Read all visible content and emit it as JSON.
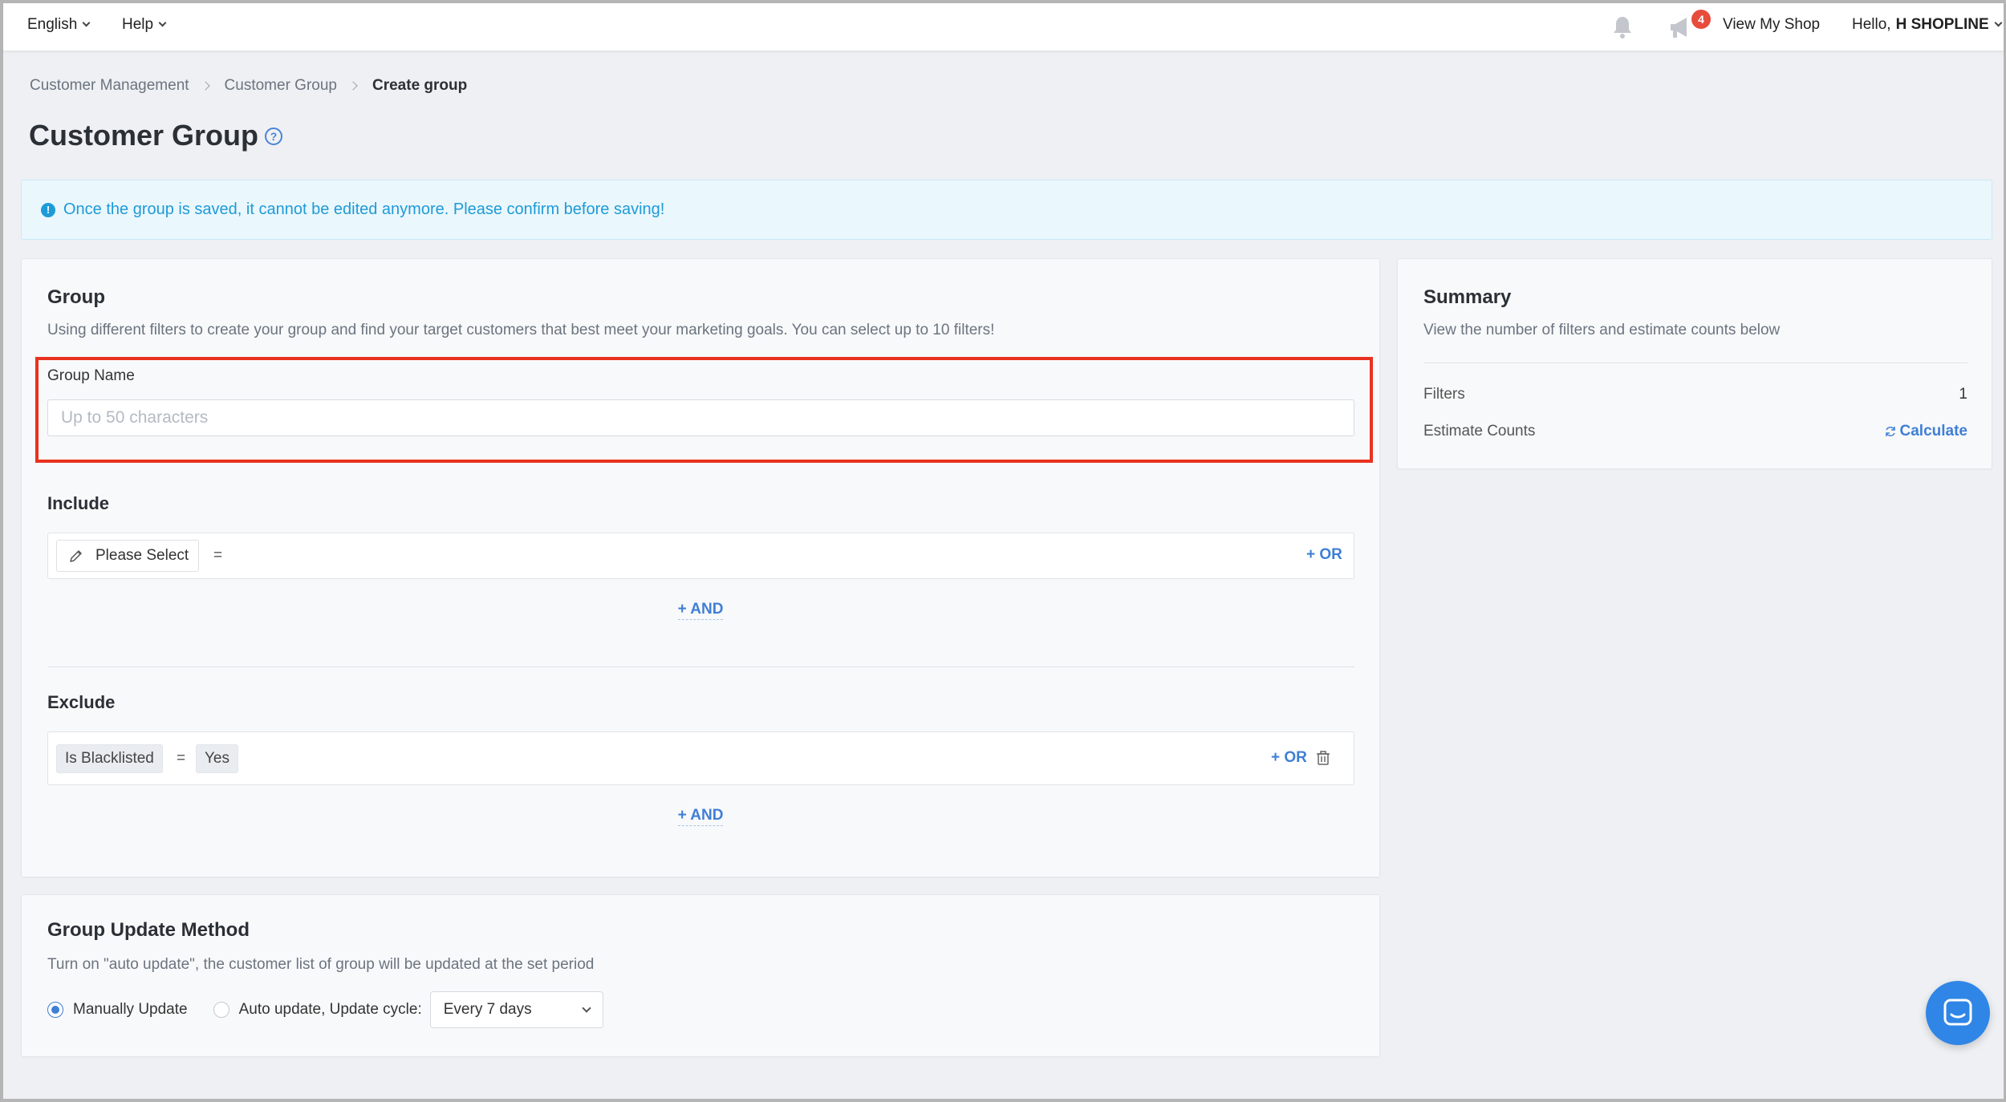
{
  "topbar": {
    "language": "English",
    "help": "Help",
    "notification_badge": "4",
    "view_shop": "View My Shop",
    "hello": "Hello,",
    "user_name": "H SHOPLINE"
  },
  "breadcrumb": [
    "Customer Management",
    "Customer Group",
    "Create group"
  ],
  "page_title": "Customer Group",
  "alert": {
    "icon": "!",
    "text": "Once the group is saved, it cannot be edited anymore. Please confirm before saving!"
  },
  "group": {
    "title": "Group",
    "description": "Using different filters to create your group and find your target customers that best meet your marketing goals. You can select up to 10 filters!",
    "name_label": "Group Name",
    "name_placeholder": "Up to 50 characters",
    "name_value": "",
    "include": {
      "title": "Include",
      "select_label": "Please Select",
      "operator": "=",
      "or_label": "+ OR",
      "and_label": "+ AND"
    },
    "exclude": {
      "title": "Exclude",
      "field": "Is Blacklisted",
      "operator": "=",
      "value": "Yes",
      "or_label": "+ OR",
      "and_label": "+ AND"
    }
  },
  "summary": {
    "title": "Summary",
    "description": "View the number of filters and estimate counts below",
    "filters_label": "Filters",
    "filters_value": "1",
    "estimate_label": "Estimate Counts",
    "calculate_label": "Calculate"
  },
  "update_method": {
    "title": "Group Update Method",
    "description": "Turn on \"auto update\", the customer list of group will be updated at the set period",
    "manual_label": "Manually Update",
    "auto_label": "Auto update, Update cycle:",
    "cycle_value": "Every 7 days",
    "selected": "manual"
  },
  "colors": {
    "accent": "#3f7fd6",
    "alert_text": "#1e9bd7",
    "highlight": "#e8321f",
    "badge": "#e74c3c"
  },
  "icons": [
    "chevron-down-icon",
    "bell-icon",
    "megaphone-icon",
    "help-circle-icon",
    "info-icon",
    "pencil-icon",
    "trash-icon",
    "refresh-icon",
    "chat-icon"
  ]
}
